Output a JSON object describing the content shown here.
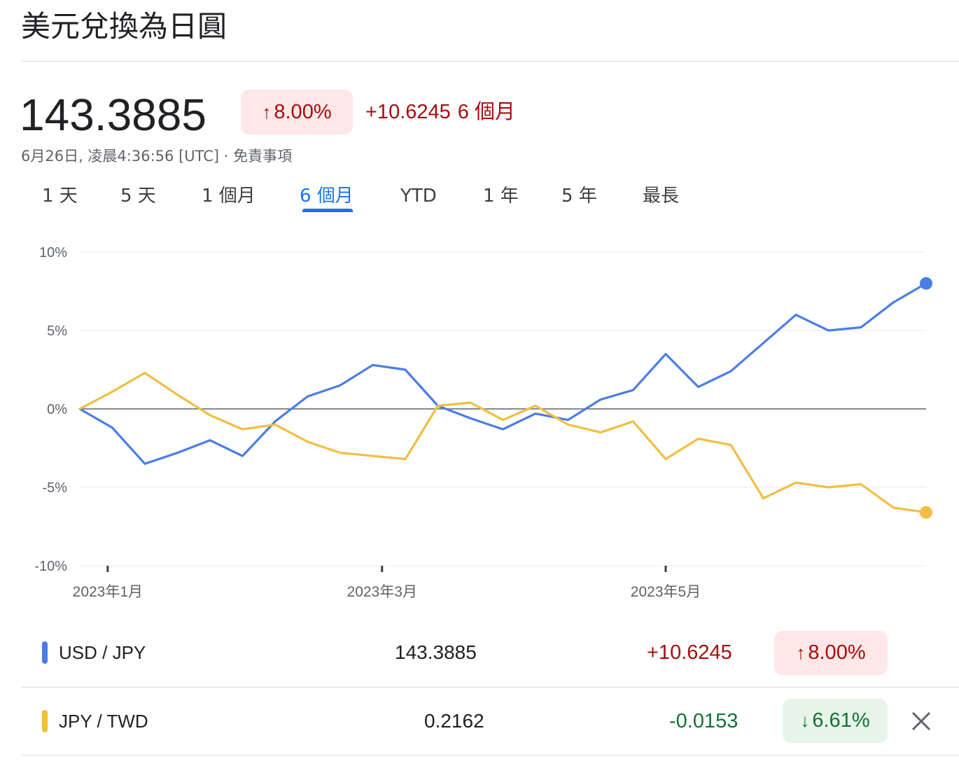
{
  "header": {
    "title": "美元兌換為日圓"
  },
  "quote": {
    "price": "143.3885",
    "percent": "8.00%",
    "change": "+10.6245",
    "period": "6 個月",
    "timestamp": "6月26日, 凌晨4:36:56 [UTC] · 免責事項"
  },
  "tabs": [
    {
      "label": "1 天"
    },
    {
      "label": "5 天"
    },
    {
      "label": "1 個月"
    },
    {
      "label": "6 個月",
      "active": true
    },
    {
      "label": "YTD"
    },
    {
      "label": "1 年"
    },
    {
      "label": "5 年"
    },
    {
      "label": "最長"
    }
  ],
  "icons": {
    "up": "arrow-up-icon",
    "down": "arrow-down-icon",
    "close": "close-icon"
  },
  "colors": {
    "usd_jpy": "#4a7de6",
    "jpy_twd": "#f2be42",
    "up_text": "#a50e0e",
    "up_bg": "#fce8e6",
    "down_text": "#137333",
    "down_bg": "#e6f4ea",
    "active_tab": "#1a73e8"
  },
  "comparison": [
    {
      "pair": "USD / JPY",
      "value": "143.3885",
      "change": "+10.6245",
      "percent": "8.00%",
      "direction": "up"
    },
    {
      "pair": "JPY / TWD",
      "value": "0.2162",
      "change": "-0.0153",
      "percent": "6.61%",
      "direction": "down"
    }
  ],
  "chart_data": {
    "type": "line",
    "ylim": [
      -10,
      10
    ],
    "yticks": [
      10,
      5,
      0,
      -5,
      -10
    ],
    "ytick_labels": [
      "10%",
      "5%",
      "0%",
      "-5%",
      "-10%"
    ],
    "x_ticks": [
      {
        "label": "2023年1月",
        "x": "2023-01-01"
      },
      {
        "label": "2023年3月",
        "x": "2023-03-01"
      },
      {
        "label": "2023年5月",
        "x": "2023-05-01"
      }
    ],
    "x": [
      "2022-12-26",
      "2023-01-02",
      "2023-01-09",
      "2023-01-16",
      "2023-01-23",
      "2023-01-30",
      "2023-02-06",
      "2023-02-13",
      "2023-02-20",
      "2023-02-27",
      "2023-03-06",
      "2023-03-13",
      "2023-03-20",
      "2023-03-27",
      "2023-04-03",
      "2023-04-10",
      "2023-04-17",
      "2023-04-24",
      "2023-05-01",
      "2023-05-08",
      "2023-05-15",
      "2023-05-22",
      "2023-05-29",
      "2023-06-05",
      "2023-06-12",
      "2023-06-19",
      "2023-06-26"
    ],
    "series": [
      {
        "name": "USD / JPY",
        "values": [
          0,
          -1.2,
          -3.5,
          -2.8,
          -2.0,
          -3.0,
          -0.8,
          0.8,
          1.5,
          2.8,
          2.5,
          0.2,
          -0.6,
          -1.3,
          -0.3,
          -0.7,
          0.6,
          1.2,
          3.5,
          1.4,
          2.4,
          4.2,
          6.0,
          5.0,
          5.2,
          6.8,
          8.0
        ]
      },
      {
        "name": "JPY / TWD",
        "values": [
          0,
          1.1,
          2.3,
          0.9,
          -0.4,
          -1.3,
          -1.0,
          -2.1,
          -2.8,
          -3.0,
          -3.2,
          0.2,
          0.4,
          -0.7,
          0.2,
          -1.0,
          -1.5,
          -0.8,
          -3.2,
          -1.9,
          -2.3,
          -5.7,
          -4.7,
          -5.0,
          -4.8,
          -6.3,
          -6.6
        ]
      }
    ]
  }
}
